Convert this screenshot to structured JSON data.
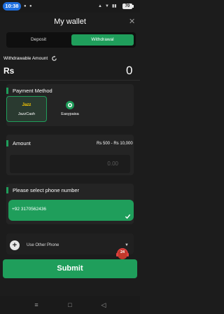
{
  "status_bar": {
    "time": "10:38",
    "battery": "70"
  },
  "header": {
    "title": "My wallet",
    "close_icon": "close-icon"
  },
  "tabs": [
    {
      "label": "Deposit",
      "active": false
    },
    {
      "label": "Withdrawal",
      "active": true
    }
  ],
  "balance": {
    "label": "Withdrawable Amount",
    "currency": "Rs",
    "value": "0"
  },
  "payment_method": {
    "label": "Payment Method",
    "options": [
      {
        "name": "JazzCash",
        "selected": true,
        "logo": "Jazz"
      },
      {
        "name": "Easypaisa",
        "selected": false
      }
    ]
  },
  "amount": {
    "label": "Amount",
    "range": "Rs 500 - Rs 10,000",
    "placeholder": "0.00"
  },
  "phone": {
    "label": "Please select phone number",
    "selected": "+92 3170562436",
    "use_other": "Use Other Phone"
  },
  "support_badge": "24",
  "submit_label": "Submit",
  "colors": {
    "accent": "#1f9e5b",
    "background": "#1c1c1c",
    "card": "#242424"
  }
}
